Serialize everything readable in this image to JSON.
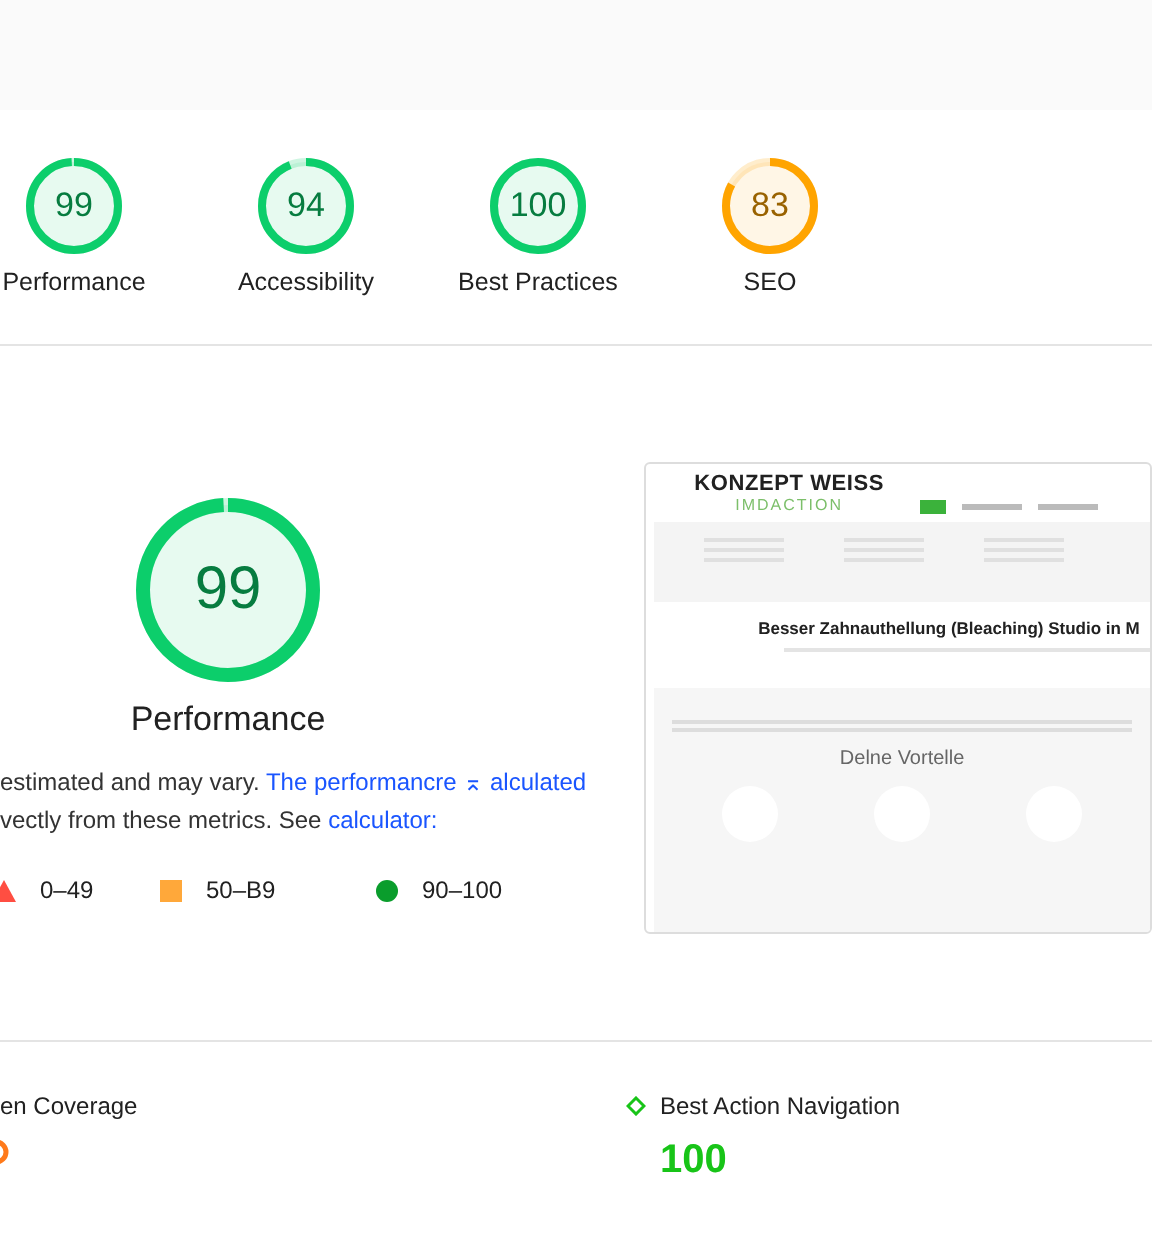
{
  "categories": [
    {
      "score": "99",
      "label": "Performance",
      "level": 0.99,
      "color": "#0cce6b"
    },
    {
      "score": "94",
      "label": "Accessibility",
      "level": 0.94,
      "color": "#0cce6b"
    },
    {
      "score": "100",
      "label": "Best Practices",
      "level": 1,
      "color": "#0cce6b"
    },
    {
      "score": "83",
      "label": "SEO",
      "level": 0.83,
      "color": "#ffa400"
    }
  ],
  "main_gauge": {
    "score": "99",
    "label": "Performance",
    "level": 0.99,
    "color": "#0cce6b"
  },
  "description": {
    "text": "estimated and may vary.",
    "link": "The performancre ⌅ alculated",
    "text2": "vectly from these metrics. See",
    "link2": "calculator:"
  },
  "legend": [
    {
      "kind": "triangle",
      "range": "0–49"
    },
    {
      "kind": "square",
      "range": "50–B9"
    },
    {
      "kind": "circle",
      "range": "90–100"
    }
  ],
  "screenshot": {
    "brand": "KONZEPT WEISS",
    "tagline": "IMDACTION",
    "headline": "Besser Zahnauthellung (Bleaching) Studio in M",
    "section_title": "Delne Vortelle"
  },
  "metrics": [
    {
      "label": "en Coverage",
      "color": "#ff7a1a"
    },
    {
      "label": "Best Action Navigation",
      "color": "#18c418",
      "value": "100"
    }
  ]
}
